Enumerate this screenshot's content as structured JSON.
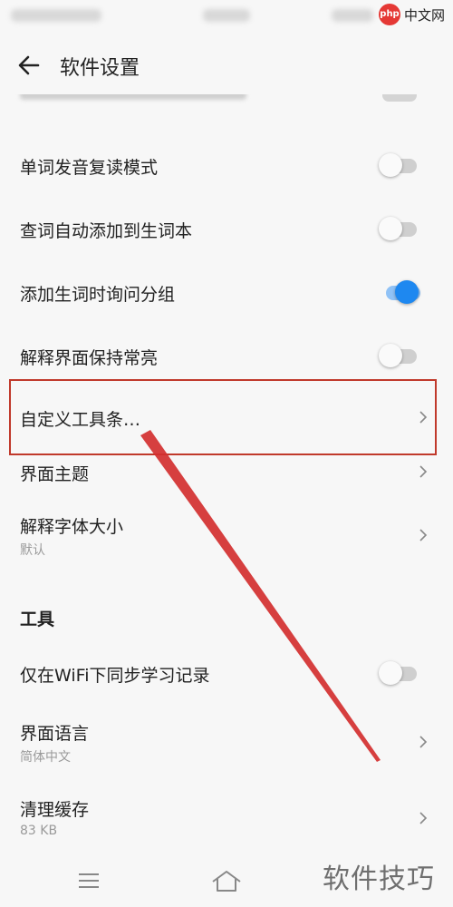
{
  "header": {
    "title": "软件设置"
  },
  "watermark_site": "中文网",
  "watermark_logo": "php",
  "settings": [
    {
      "label": "单词发音复读模式",
      "toggle": false
    },
    {
      "label": "查词自动添加到生词本",
      "toggle": false
    },
    {
      "label": "添加生词时询问分组",
      "toggle": true
    },
    {
      "label": "解释界面保持常亮",
      "toggle": false
    }
  ],
  "links": [
    {
      "label": "自定义工具条…"
    },
    {
      "label": "界面主题"
    },
    {
      "label": "解释字体大小",
      "value": "默认"
    }
  ],
  "tools_section": {
    "title": "工具",
    "wifi_sync": {
      "label": "仅在WiFi下同步学习记录",
      "toggle": false
    },
    "language": {
      "label": "界面语言",
      "value": "简体中文"
    },
    "cache": {
      "label": "清理缓存",
      "value": "83 KB"
    }
  },
  "footer_watermark": "软件技巧",
  "colors": {
    "accent": "#1e88f0",
    "highlight": "#c0392b"
  }
}
